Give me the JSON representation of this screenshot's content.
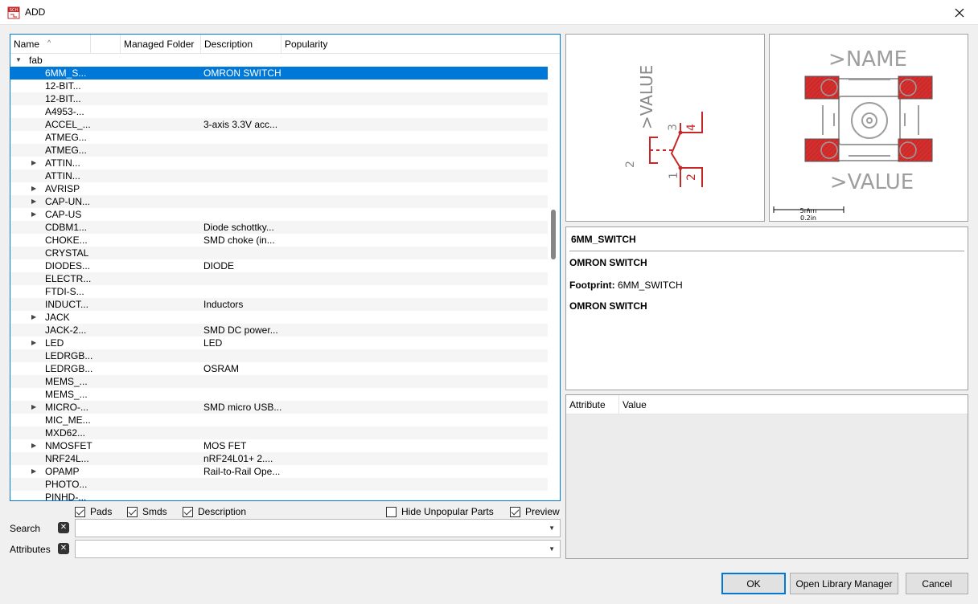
{
  "window": {
    "title": "ADD",
    "icon": "sch-app-icon"
  },
  "tree": {
    "columns": [
      "Name",
      "",
      "Managed Folder",
      "Description",
      "Popularity"
    ],
    "rows": [
      {
        "name": "fab",
        "desc": "",
        "expander": "▼",
        "folder": true
      },
      {
        "name": "6MM_S...",
        "desc": "OMRON SWITCH",
        "expander": "",
        "selected": true
      },
      {
        "name": "12-BIT...",
        "desc": "",
        "expander": ""
      },
      {
        "name": "12-BIT...",
        "desc": "",
        "expander": ""
      },
      {
        "name": "A4953-...",
        "desc": "",
        "expander": ""
      },
      {
        "name": "ACCEL_...",
        "desc": "3-axis 3.3V acc...",
        "expander": ""
      },
      {
        "name": "ATMEG...",
        "desc": "",
        "expander": ""
      },
      {
        "name": "ATMEG...",
        "desc": "",
        "expander": ""
      },
      {
        "name": "ATTIN...",
        "desc": "",
        "expander": "▶"
      },
      {
        "name": "ATTIN...",
        "desc": "",
        "expander": ""
      },
      {
        "name": "AVRISP",
        "desc": "",
        "expander": "▶"
      },
      {
        "name": "CAP-UN...",
        "desc": "",
        "expander": "▶"
      },
      {
        "name": "CAP-US",
        "desc": "",
        "expander": "▶"
      },
      {
        "name": "CDBM1...",
        "desc": "Diode schottky...",
        "expander": ""
      },
      {
        "name": "CHOKE...",
        "desc": "SMD choke (in...",
        "expander": ""
      },
      {
        "name": "CRYSTAL",
        "desc": "",
        "expander": ""
      },
      {
        "name": "DIODES...",
        "desc": "DIODE",
        "expander": ""
      },
      {
        "name": "ELECTR...",
        "desc": "",
        "expander": ""
      },
      {
        "name": "FTDI-S...",
        "desc": "",
        "expander": ""
      },
      {
        "name": "INDUCT...",
        "desc": "Inductors",
        "expander": ""
      },
      {
        "name": "JACK",
        "desc": "",
        "expander": "▶"
      },
      {
        "name": "JACK-2...",
        "desc": "SMD DC power...",
        "expander": ""
      },
      {
        "name": "LED",
        "desc": "LED",
        "expander": "▶"
      },
      {
        "name": "LEDRGB...",
        "desc": "",
        "expander": ""
      },
      {
        "name": "LEDRGB...",
        "desc": "OSRAM",
        "expander": ""
      },
      {
        "name": "MEMS_...",
        "desc": "",
        "expander": ""
      },
      {
        "name": "MEMS_...",
        "desc": "",
        "expander": ""
      },
      {
        "name": "MICRO-...",
        "desc": "SMD micro USB...",
        "expander": "▶"
      },
      {
        "name": "MIC_ME...",
        "desc": "",
        "expander": ""
      },
      {
        "name": "MXD62...",
        "desc": "",
        "expander": ""
      },
      {
        "name": "NMOSFET",
        "desc": "MOS FET",
        "expander": "▶"
      },
      {
        "name": "NRF24L...",
        "desc": "nRF24L01+ 2....",
        "expander": ""
      },
      {
        "name": "OPAMP",
        "desc": "Rail-to-Rail Ope...",
        "expander": "▶"
      },
      {
        "name": "PHOTO...",
        "desc": "",
        "expander": ""
      },
      {
        "name": "PINHD-...",
        "desc": "",
        "expander": ""
      }
    ]
  },
  "options": {
    "pads": {
      "label": "Pads",
      "checked": true
    },
    "smds": {
      "label": "Smds",
      "checked": true
    },
    "description": {
      "label": "Description",
      "checked": true
    },
    "hide_unpopular": {
      "label": "Hide Unpopular Parts",
      "checked": false
    },
    "preview": {
      "label": "Preview",
      "checked": true
    }
  },
  "search": {
    "label": "Search",
    "value": ""
  },
  "attributes_filter": {
    "label": "Attributes",
    "value": ""
  },
  "schematic": {
    "value_label": ">VALUE",
    "pin1": "1",
    "pin2": "2",
    "pin3": "3",
    "pin4": "4",
    "part_label": "2"
  },
  "footprint": {
    "name_label": ">NAME",
    "value_label": ">VALUE",
    "scale_mm": "5mm",
    "scale_in": "0.2in"
  },
  "info": {
    "title": "6MM_SWITCH",
    "description": "OMRON SWITCH",
    "footprint_label": "Footprint:",
    "footprint_value": "6MM_SWITCH",
    "package_description": "OMRON SWITCH"
  },
  "attributes_table": {
    "columns": [
      "Attribute",
      "Value"
    ]
  },
  "buttons": {
    "ok": "OK",
    "library_manager": "Open Library Manager",
    "cancel": "Cancel"
  },
  "colors": {
    "accent": "#0078d7",
    "pad_red": "#d32f2f"
  }
}
